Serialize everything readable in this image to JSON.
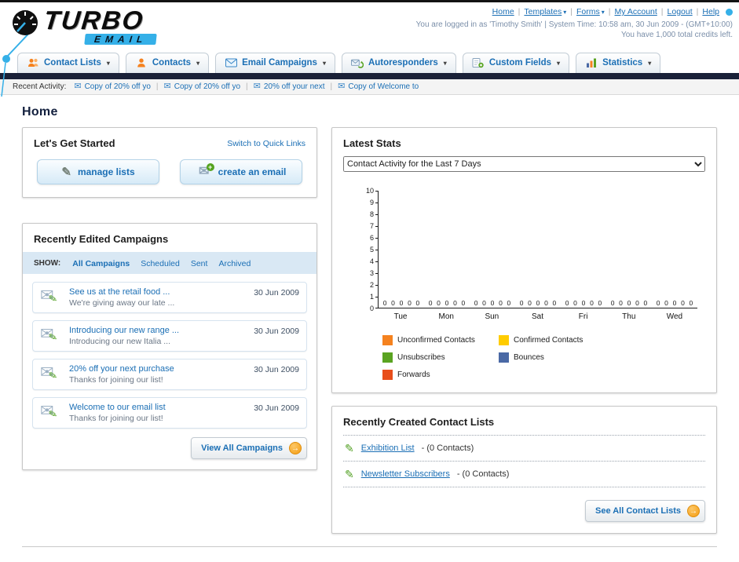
{
  "header": {
    "logo_primary": "TURBO",
    "logo_secondary": "EMAIL",
    "links": [
      {
        "label": "Home",
        "dropdown": false
      },
      {
        "label": "Templates",
        "dropdown": true
      },
      {
        "label": "Forms",
        "dropdown": true
      },
      {
        "label": "My Account",
        "dropdown": false
      },
      {
        "label": "Logout",
        "dropdown": false
      },
      {
        "label": "Help",
        "dropdown": false
      }
    ],
    "login_line": "You are logged in as 'Timothy Smith' | System Time: 10:58 am, 30 Jun 2009 - (GMT+10:00)",
    "credits_line": "You have 1,000 total credits left."
  },
  "nav": {
    "tabs": [
      {
        "label": "Contact Lists",
        "icon": "contact-lists-icon"
      },
      {
        "label": "Contacts",
        "icon": "contacts-icon"
      },
      {
        "label": "Email Campaigns",
        "icon": "email-campaigns-icon"
      },
      {
        "label": "Autoresponders",
        "icon": "autoresponders-icon"
      },
      {
        "label": "Custom Fields",
        "icon": "custom-fields-icon"
      },
      {
        "label": "Statistics",
        "icon": "statistics-icon"
      }
    ]
  },
  "recent_activity": {
    "label": "Recent Activity:",
    "items": [
      "Copy of 20% off yo",
      "Copy of 20% off yo",
      "20% off your next",
      "Copy of Welcome to"
    ]
  },
  "page_title": "Home",
  "get_started": {
    "title": "Let's Get Started",
    "switch_link": "Switch to Quick Links",
    "manage_lists_label": "manage lists",
    "create_email_label": "create an email"
  },
  "campaigns": {
    "title": "Recently Edited Campaigns",
    "show_label": "SHOW:",
    "filters": [
      {
        "label": "All Campaigns",
        "active": true
      },
      {
        "label": "Scheduled",
        "active": false
      },
      {
        "label": "Sent",
        "active": false
      },
      {
        "label": "Archived",
        "active": false
      }
    ],
    "items": [
      {
        "title": "See us at the retail food ...",
        "subtitle": "We're giving away our late ...",
        "date": "30 Jun 2009"
      },
      {
        "title": "Introducing our new range ...",
        "subtitle": "Introducing our new Italia ...",
        "date": "30 Jun 2009"
      },
      {
        "title": "20% off your next purchase",
        "subtitle": "Thanks for joining our list!",
        "date": "30 Jun 2009"
      },
      {
        "title": "Welcome to our email list",
        "subtitle": "Thanks for joining our list!",
        "date": "30 Jun 2009"
      }
    ],
    "view_all_label": "View All Campaigns"
  },
  "stats": {
    "title": "Latest Stats",
    "selected_option": "Contact Activity for the Last 7 Days"
  },
  "chart_data": {
    "type": "bar",
    "title": "Contact Activity for the Last 7 Days",
    "categories": [
      "Tue",
      "Mon",
      "Sun",
      "Sat",
      "Fri",
      "Thu",
      "Wed"
    ],
    "series": [
      {
        "name": "Unconfirmed Contacts",
        "color": "#f5821f",
        "values": [
          0,
          0,
          0,
          0,
          0,
          0,
          0
        ]
      },
      {
        "name": "Confirmed Contacts",
        "color": "#ffcc00",
        "values": [
          0,
          0,
          0,
          0,
          0,
          0,
          0
        ]
      },
      {
        "name": "Unsubscribes",
        "color": "#5aa321",
        "values": [
          0,
          0,
          0,
          0,
          0,
          0,
          0
        ]
      },
      {
        "name": "Bounces",
        "color": "#4a69a5",
        "values": [
          0,
          0,
          0,
          0,
          0,
          0,
          0
        ]
      },
      {
        "name": "Forwards",
        "color": "#e84e1b",
        "values": [
          0,
          0,
          0,
          0,
          0,
          0,
          0
        ]
      }
    ],
    "ylim": [
      0,
      10
    ],
    "ytick_step": 1,
    "grid": false,
    "legend_position": "bottom",
    "value_labels_shown": true
  },
  "contact_lists": {
    "title": "Recently Created Contact Lists",
    "items": [
      {
        "name": "Exhibition List",
        "count": "(0 Contacts)"
      },
      {
        "name": "Newsletter Subscribers",
        "count": "(0 Contacts)"
      }
    ],
    "see_all_label": "See All Contact Lists"
  },
  "colors": {
    "link_blue": "#1b6fb5",
    "dark_bar": "#1a2138",
    "accent_orange": "#f59d12",
    "logo_blue": "#35b0e8"
  }
}
